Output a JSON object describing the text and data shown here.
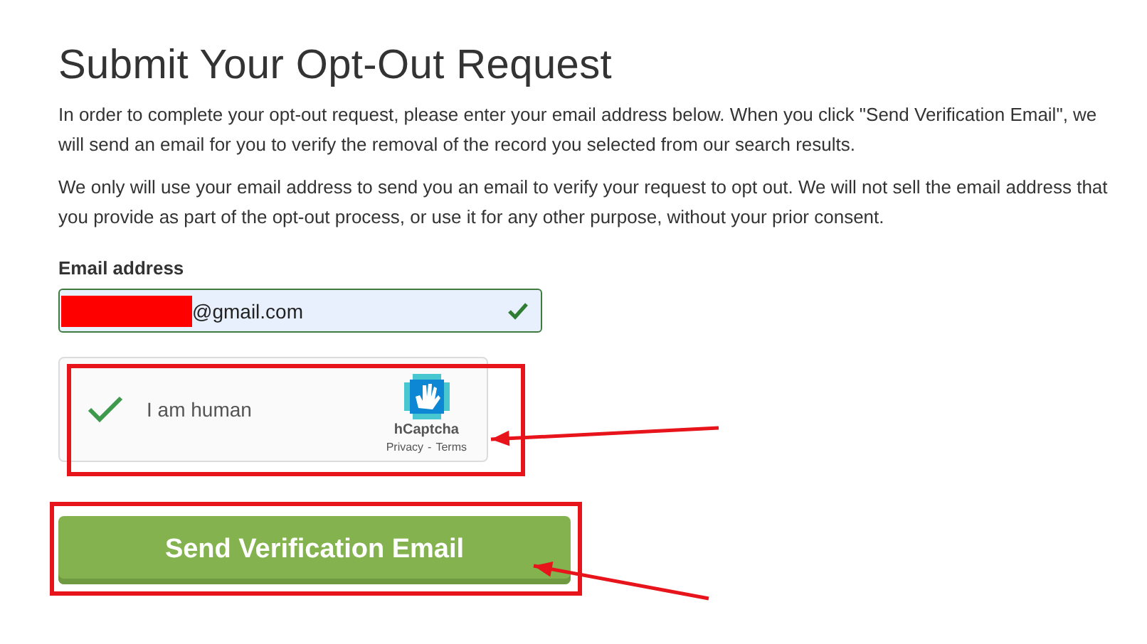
{
  "title": "Submit Your Opt-Out Request",
  "paragraphs": [
    "In order to complete your opt-out request, please enter your email address below. When you click \"Send Verification Email\", we will send an email for you to verify the removal of the record you selected from our search results.",
    "We only will use your email address to send you an email to verify your request to opt out. We will not sell the email address that you provide as part of the opt-out process, or use it for any other purpose, without your prior consent."
  ],
  "email": {
    "label": "Email address",
    "value": "@gmail.com",
    "redacted": true,
    "valid": true
  },
  "captcha": {
    "label": "I am human",
    "checked": true,
    "brand": "hCaptcha",
    "links": [
      "Privacy",
      "-",
      "Terms"
    ],
    "highlighted": true
  },
  "submit": {
    "label": "Send Verification Email",
    "highlighted": true
  }
}
